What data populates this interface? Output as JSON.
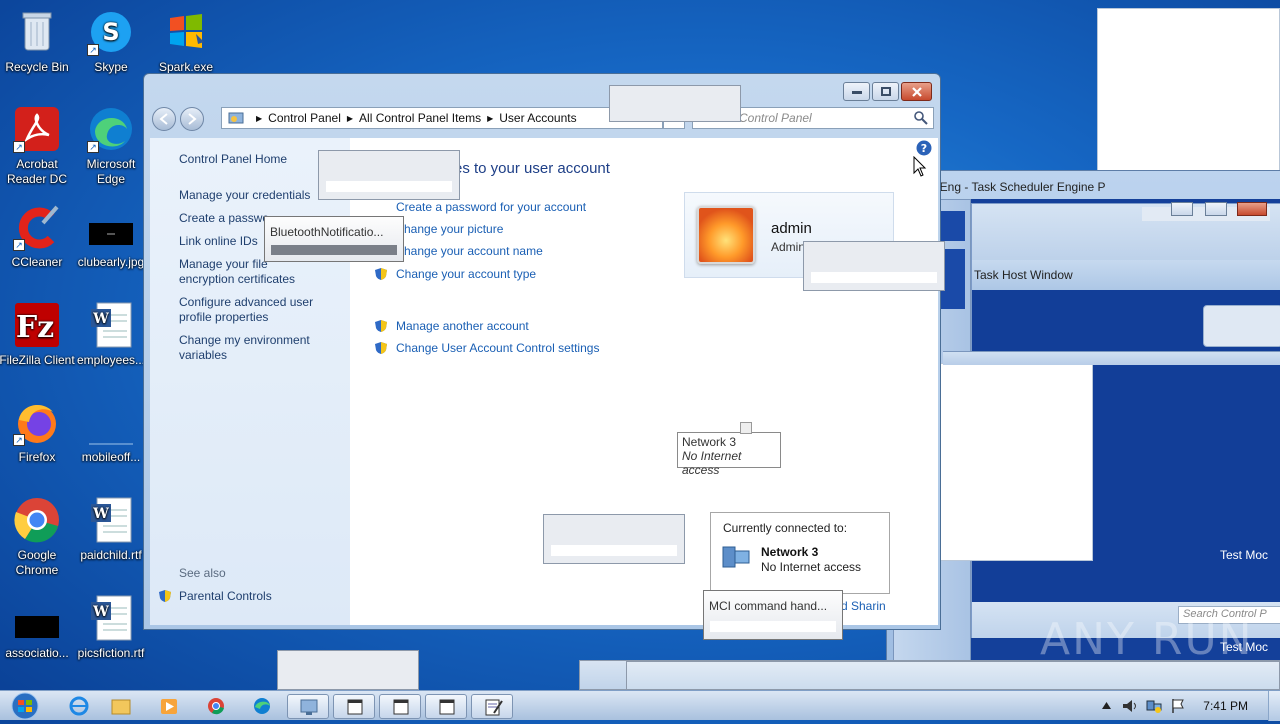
{
  "desktop": {
    "icons": [
      {
        "label": "Recycle Bin"
      },
      {
        "label": "Skype"
      },
      {
        "label": "Spark.exe"
      },
      {
        "label": "Acrobat Reader DC"
      },
      {
        "label": "Microsoft Edge"
      },
      {
        "label": "CCleaner"
      },
      {
        "label": "clubearly.jpg"
      },
      {
        "label": "FileZilla Client"
      },
      {
        "label": "employees..."
      },
      {
        "label": "Firefox"
      },
      {
        "label": "mobileoff..."
      },
      {
        "label": "Google Chrome"
      },
      {
        "label": "paidchild.rtf"
      },
      {
        "label": "associatio..."
      },
      {
        "label": "picsfiction.rtf"
      }
    ]
  },
  "window": {
    "breadcrumb": [
      "Control Panel",
      "All Control Panel Items",
      "User Accounts"
    ],
    "search_placeholder": "Control Panel",
    "left": {
      "home": "Control Panel Home",
      "links": [
        "Manage your credentials",
        "Create a passwo",
        "Link online IDs",
        "Manage your file encryption certificates",
        "Configure advanced user profile properties",
        "Change my environment variables"
      ],
      "see_also": "See also",
      "parental": "Parental Controls"
    },
    "heading": "es to your user account",
    "actions": [
      "Create a password for your account",
      "hange your picture",
      "hange your account name",
      "Change your account type"
    ],
    "actions2": [
      "Manage another account",
      "Change User Account Control settings"
    ],
    "user": {
      "name": "admin",
      "role": "Admin"
    },
    "network_tooltip": {
      "name": "Network  3",
      "status": "No Internet access"
    },
    "connected": {
      "title": "Currently connected to:",
      "name": "Network  3",
      "status": "No Internet access",
      "sharing": "d Sharin"
    }
  },
  "popups": {
    "bluetooth": "BluetoothNotificatio...",
    "mci": "MCI command hand..."
  },
  "taskeng": {
    "title": "TaskEng - Task Scheduler Engine P",
    "host": "Task Host Window",
    "test1": "Test Moc",
    "test2": "Test Moc",
    "search": "Search Control P"
  },
  "watermark": "ANY RUN",
  "taskbar": {
    "clock": "7:41 PM"
  }
}
